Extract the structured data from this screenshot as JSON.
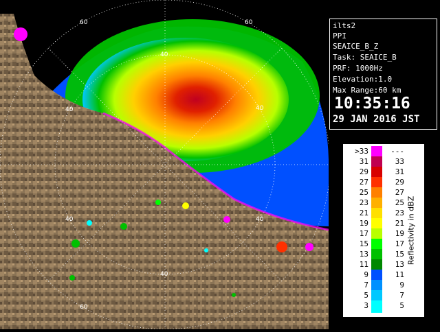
{
  "info": {
    "station": "ilts2",
    "product": "PPI",
    "field": "SEAICE_B_Z",
    "task": "Task: SEAICE_B",
    "prf": "PRF: 1000Hz",
    "elevation": "Elevation:1.0",
    "max_range": "Max Range:60 km",
    "time": "10:35:16",
    "date": "29 JAN 2016 JST"
  },
  "range_labels": {
    "r40_north": "40",
    "r60_north": "60",
    "r60_ne": "60",
    "r40_east": "40",
    "r40_west": "40",
    "r40_sw": "40",
    "r40_south": "40",
    "r60_south": "60",
    "r40_se": "40"
  },
  "legend": {
    "title": "Reflectivity in dBZ",
    "bands": [
      {
        "left": ">33",
        "right": "---",
        "color": "#ff00ff"
      },
      {
        "left": "31",
        "right": "33",
        "color": "#c00050"
      },
      {
        "left": "29",
        "right": "31",
        "color": "#d80000"
      },
      {
        "left": "27",
        "right": "29",
        "color": "#ff3000"
      },
      {
        "left": "25",
        "right": "27",
        "color": "#ff8000"
      },
      {
        "left": "23",
        "right": "25",
        "color": "#ffb000"
      },
      {
        "left": "21",
        "right": "23",
        "color": "#ffe000"
      },
      {
        "left": "19",
        "right": "21",
        "color": "#ffff00"
      },
      {
        "left": "17",
        "right": "19",
        "color": "#b8ff00"
      },
      {
        "left": "15",
        "right": "17",
        "color": "#00ff00"
      },
      {
        "left": "13",
        "right": "15",
        "color": "#00c000"
      },
      {
        "left": "11",
        "right": "13",
        "color": "#008800"
      },
      {
        "left": "9",
        "right": "11",
        "color": "#0050ff"
      },
      {
        "left": "7",
        "right": "9",
        "color": "#0090ff"
      },
      {
        "left": "5",
        "right": "7",
        "color": "#00c8ff"
      },
      {
        "left": "3",
        "right": "5",
        "color": "#00ffff"
      }
    ]
  },
  "colors": {
    "sea": "#0060ff",
    "land": "#8a7355",
    "no_echo": "#000000"
  }
}
